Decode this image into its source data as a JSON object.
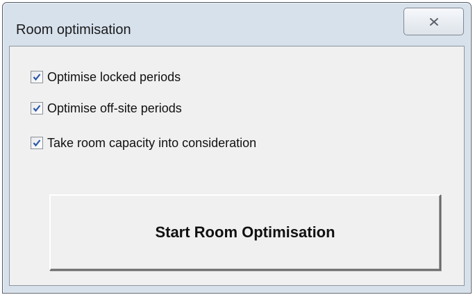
{
  "window": {
    "title": "Room optimisation",
    "close_icon": "close-icon"
  },
  "options": [
    {
      "label": "Optimise locked periods",
      "checked": true
    },
    {
      "label": "Optimise off-site periods",
      "checked": true
    },
    {
      "label": "Take room capacity into consideration",
      "checked": true
    }
  ],
  "actions": {
    "start_label": "Start Room Optimisation"
  },
  "colors": {
    "frame": "#d7e1ec",
    "client_background": "#f0f0f0",
    "checkmark": "#2a56a8"
  }
}
